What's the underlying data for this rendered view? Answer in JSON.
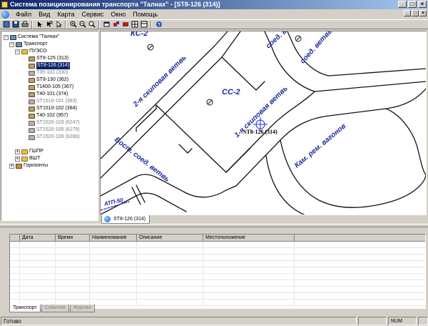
{
  "window": {
    "title": "Система позиционирования транспорта \"Талнах\" - [ST8-126 (314)]",
    "min_label": "_",
    "max_label": "□",
    "close_label": "×"
  },
  "menu": {
    "items": [
      "Файл",
      "Вид",
      "Карта",
      "Сервис",
      "Окно",
      "Помощь"
    ]
  },
  "toolbar": {
    "buttons": [
      "new-icon",
      "save-icon",
      "print-icon",
      "arrow-icon",
      "arrow-select-icon",
      "pointer-icon",
      "zoom-in-icon",
      "zoom-out-icon",
      "zoom-fit-icon",
      "open-window-icon",
      "route-icon",
      "layers-icon",
      "grid-icon",
      "split-icon",
      "help-icon"
    ]
  },
  "tree": {
    "root": "Система \"Талнах\"",
    "transport": "Транспорт",
    "group1": "ПУЭСО",
    "vehicles": [
      {
        "label": "ST8-125 (313)",
        "state": "active"
      },
      {
        "label": "ST8-126 (314)",
        "state": "selected"
      },
      {
        "label": "T35-101 (330)",
        "state": "inactive"
      },
      {
        "label": "ST8-130 (362)",
        "state": "active"
      },
      {
        "label": "T1400-105 (367)",
        "state": "active"
      },
      {
        "label": "T40-101 (374)",
        "state": "active"
      },
      {
        "label": "ST1510-101 (383)",
        "state": "inactive"
      },
      {
        "label": "ST1510-102 (384)",
        "state": "active"
      },
      {
        "label": "T40-102 (957)",
        "state": "active"
      },
      {
        "label": "ST1520-103 (6247)",
        "state": "inactive"
      },
      {
        "label": "ST1520-105 (6279)",
        "state": "inactive"
      },
      {
        "label": "ST1520-106 (6280)",
        "state": "inactive"
      }
    ],
    "group2": "ГШПР",
    "group3": "ВШТ",
    "horizons": "Горизонты"
  },
  "map": {
    "labels": {
      "ks2": "КС-2",
      "soed_vetv": "соед. ветвь",
      "skip2": "2-я скиповая ветвь",
      "ss2": "СС-2",
      "skip1": "1-я скиповая ветвь",
      "vehicle": "ST8-126 (314)",
      "kam_rem": "Кам. рем. вагонов",
      "vost_soed": "Вост. соед. ветвь",
      "atp": "АТП-50"
    },
    "tab_label": "ST8-126 (314)"
  },
  "grid": {
    "columns": [
      "Дата",
      "Время",
      "Наименование",
      "Описание",
      "Местоположение"
    ],
    "row_count": 10
  },
  "bottom_tabs": [
    "Транспорт",
    "События",
    "Журнал"
  ],
  "status": {
    "text": "Готово",
    "num": "NUM"
  }
}
